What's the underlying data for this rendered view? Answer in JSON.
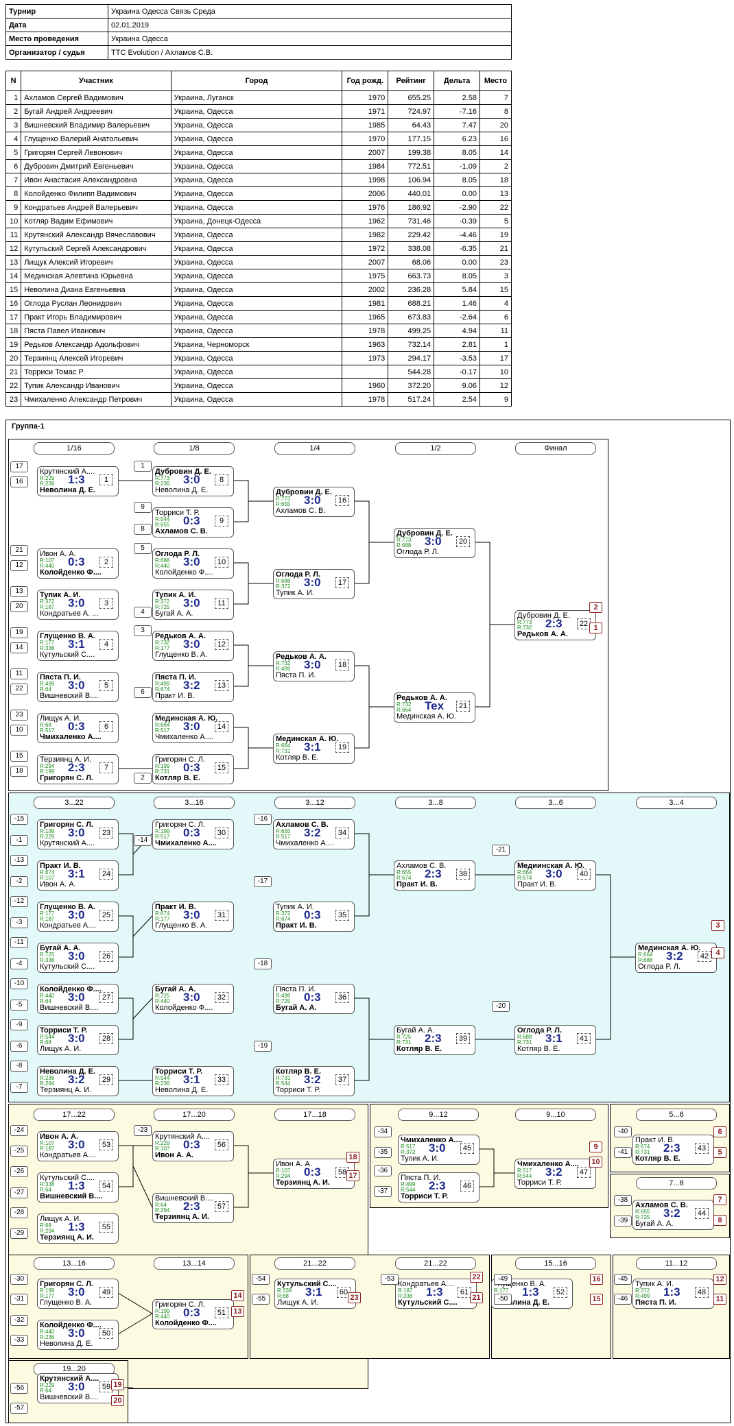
{
  "info": [
    {
      "k": "Турнир",
      "v": "Украина Одесса Связь Среда"
    },
    {
      "k": "Дата",
      "v": "02.01.2019"
    },
    {
      "k": "Место проведения",
      "v": "Украина Одесса"
    },
    {
      "k": "Организатор / судья",
      "v": "TTC Evolution / Ахламов С.В."
    }
  ],
  "players_header": [
    "N",
    "Участник",
    "Город",
    "Год рожд.",
    "Рейтинг",
    "Дельта",
    "Место"
  ],
  "players": [
    [
      "1",
      "Ахламов Сергей Вадимович",
      "Украина, Луганск",
      "1970",
      "655.25",
      "2.58",
      "7"
    ],
    [
      "2",
      "Бугай Андрей Андреевич",
      "Украина, Одесса",
      "1971",
      "724.97",
      "-7.16",
      "8"
    ],
    [
      "3",
      "Вишневский Владимир Валерьевич",
      "Украина, Одесса",
      "1985",
      "64.43",
      "7.47",
      "20"
    ],
    [
      "4",
      "Глущенко Валерий Анатольевич",
      "Украина, Одесса",
      "1970",
      "177.15",
      "6.23",
      "16"
    ],
    [
      "5",
      "Григорян Сергей Левонович",
      "Украина, Одесса",
      "2007",
      "199.38",
      "8.05",
      "14"
    ],
    [
      "6",
      "Дубровин Дмитрий Евгеньевич",
      "Украина, Одесса",
      "1984",
      "772.51",
      "-1.09",
      "2"
    ],
    [
      "7",
      "Ивон Анастасия Александровна",
      "Украина, Одесса",
      "1998",
      "106.94",
      "8.05",
      "18"
    ],
    [
      "8",
      "Колойденко Филипп Вадимович",
      "Украина, Одесса",
      "2006",
      "440.01",
      "0.00",
      "13"
    ],
    [
      "9",
      "Кондратьев Андрей Валерьевич",
      "Украина, Одесса",
      "1976",
      "186.92",
      "-2.90",
      "22"
    ],
    [
      "10",
      "Котляр Вадим Ефимович",
      "Украина, Донецк-Одесса",
      "1962",
      "731.46",
      "-0.39",
      "5"
    ],
    [
      "11",
      "Крутянский Александр Вячеславович",
      "Украина, Одесса",
      "1982",
      "229.42",
      "-4.46",
      "19"
    ],
    [
      "12",
      "Кутульский Сергей Александрович",
      "Украина, Одесса",
      "1972",
      "338.08",
      "-6.35",
      "21"
    ],
    [
      "13",
      "Лищук Алексий Игоревич",
      "Украина, Одесса",
      "2007",
      "68.06",
      "0.00",
      "23"
    ],
    [
      "14",
      "Мединская Алевтина Юрьевна",
      "Украина, Одесса",
      "1975",
      "663.73",
      "8.05",
      "3"
    ],
    [
      "15",
      "Неволина Диана Евгеньевна",
      "Украина, Одесса",
      "2002",
      "236.28",
      "5.84",
      "15"
    ],
    [
      "16",
      "Оглода Руслан Леонидович",
      "Украина, Одесса",
      "1981",
      "688.21",
      "1.46",
      "4"
    ],
    [
      "17",
      "Практ Игорь Владимирович",
      "Украина, Одесса",
      "1965",
      "673.83",
      "-2.64",
      "6"
    ],
    [
      "18",
      "Пяста Павел Иванович",
      "Украина, Одесса",
      "1978",
      "499.25",
      "4.94",
      "11"
    ],
    [
      "19",
      "Редьков Александр Адольфович",
      "Украина, Черноморск",
      "1963",
      "732.14",
      "2.81",
      "1"
    ],
    [
      "20",
      "Терзиянц Алексей Игоревич",
      "Украина, Одесса",
      "1973",
      "294.17",
      "-3.53",
      "17"
    ],
    [
      "21",
      "Торриси Томас Р",
      "Украина, Одесса",
      "",
      "544.28",
      "-0.17",
      "10"
    ],
    [
      "22",
      "Тупик Александр Иванович",
      "Украина, Одесса",
      "1960",
      "372.20",
      "9.06",
      "12"
    ],
    [
      "23",
      "Чмихаленко Александр Петрович",
      "Украина, Одесса",
      "1978",
      "517.24",
      "2.54",
      "9"
    ]
  ],
  "group_title": "Группа-1",
  "rounds": [
    {
      "label": "1/16"
    },
    {
      "label": "1/8"
    },
    {
      "label": "1/4"
    },
    {
      "label": "1/2"
    },
    {
      "label": "Финал"
    },
    {
      "label": "3...22"
    },
    {
      "label": "3...16"
    },
    {
      "label": "3...12"
    },
    {
      "label": "3...8"
    },
    {
      "label": "3...6"
    },
    {
      "label": "3...4"
    },
    {
      "label": "17...22"
    },
    {
      "label": "17...20"
    },
    {
      "label": "17...18"
    },
    {
      "label": "9...12"
    },
    {
      "label": "9...10"
    },
    {
      "label": "5...6"
    },
    {
      "label": "7...8"
    },
    {
      "label": "13...16"
    },
    {
      "label": "13...14"
    },
    {
      "label": "21...22"
    },
    {
      "label": "21...22"
    },
    {
      "label": "15...16"
    },
    {
      "label": "11...12"
    },
    {
      "label": "19...20"
    }
  ],
  "matches": [
    {
      "t": "Крутянский А....",
      "b": "Неволина Д. Е.",
      "r1": "R:229",
      "r2": "R:236",
      "s": "1:3",
      "n": "1",
      "w": "b"
    },
    {
      "t": "Ивон А. А.",
      "b": "Колойденко Ф....",
      "r1": "R:107",
      "r2": "R:440",
      "s": "0:3",
      "n": "2",
      "w": "b"
    },
    {
      "t": "Тупик А. И.",
      "b": "Кондратьев А. ...",
      "r1": "R:372",
      "r2": "R:187",
      "s": "3:0",
      "n": "3",
      "w": "t"
    },
    {
      "t": "Глущенко В. А.",
      "b": "Кутульский С....",
      "r1": "R:177",
      "r2": "R:338",
      "s": "3:1",
      "n": "4",
      "w": "t"
    },
    {
      "t": "Пяста П. И.",
      "b": "Вишневский В....",
      "r1": "R:499",
      "r2": "R:64",
      "s": "3:0",
      "n": "5",
      "w": "t"
    },
    {
      "t": "Лищук А. И.",
      "b": "Чмихаленко А....",
      "r1": "R:68",
      "r2": "R:517",
      "s": "0:3",
      "n": "6",
      "w": "b"
    },
    {
      "t": "Терзиянц А. И.",
      "b": "Григорян С. Л.",
      "r1": "R:294",
      "r2": "R:199",
      "s": "2:3",
      "n": "7",
      "w": "b"
    },
    {
      "t": "Дубровин Д. Е.",
      "b": "Неволина Д. Е.",
      "r1": "R:773",
      "r2": "R:236",
      "s": "3:0",
      "n": "8",
      "w": "t"
    },
    {
      "t": "Торриси Т. Р.",
      "b": "Ахламов С. В.",
      "r1": "R:544",
      "r2": "R:655",
      "s": "0:3",
      "n": "9",
      "w": "b"
    },
    {
      "t": "Оглода Р. Л.",
      "b": "Колойденко Ф....",
      "r1": "R:688",
      "r2": "R:440",
      "s": "3:0",
      "n": "10",
      "w": "t"
    },
    {
      "t": "Тупик А. И.",
      "b": "Бугай А. А.",
      "r1": "R:372",
      "r2": "R:725",
      "s": "3:0",
      "n": "11",
      "w": "t"
    },
    {
      "t": "Редьков А. А.",
      "b": "Глущенко В. А.",
      "r1": "R:732",
      "r2": "R:177",
      "s": "3:0",
      "n": "12",
      "w": "t"
    },
    {
      "t": "Пяста П. И.",
      "b": "Практ И. В.",
      "r1": "R:499",
      "r2": "R:674",
      "s": "3:2",
      "n": "13",
      "w": "t"
    },
    {
      "t": "Мединская А. Ю.",
      "b": "Чмихаленко А....",
      "r1": "R:664",
      "r2": "R:517",
      "s": "3:0",
      "n": "14",
      "w": "t"
    },
    {
      "t": "Григорян С. Л.",
      "b": "Котляр В. Е.",
      "r1": "R:199",
      "r2": "R:731",
      "s": "0:3",
      "n": "15",
      "w": "b"
    },
    {
      "t": "Дубровин Д. Е.",
      "b": "Ахламов С. В.",
      "r1": "R:773",
      "r2": "R:655",
      "s": "3:0",
      "n": "16",
      "w": "t"
    },
    {
      "t": "Оглода Р. Л.",
      "b": "Тупик А. И.",
      "r1": "R:688",
      "r2": "R:372",
      "s": "3:0",
      "n": "17",
      "w": "t"
    },
    {
      "t": "Редьков А. А.",
      "b": "Пяста П. И.",
      "r1": "R:732",
      "r2": "R:499",
      "s": "3:0",
      "n": "18",
      "w": "t"
    },
    {
      "t": "Мединская А. Ю.",
      "b": "Котляр В. Е.",
      "r1": "R:664",
      "r2": "R:731",
      "s": "3:1",
      "n": "19",
      "w": "t"
    },
    {
      "t": "Дубровин Д. Е.",
      "b": "Оглода Р. Л.",
      "r1": "R:773",
      "r2": "R:688",
      "s": "3:0",
      "n": "20",
      "w": "t"
    },
    {
      "t": "Редьков А. А.",
      "b": "Мединская А. Ю.",
      "r1": "R:732",
      "r2": "R:664",
      "s": "Tex",
      "n": "21",
      "w": "t"
    },
    {
      "t": "Дубровин Д. Е.",
      "b": "Редьков А. А.",
      "r1": "R:773",
      "r2": "R:732",
      "s": "2:3",
      "n": "22",
      "w": "b"
    },
    {
      "t": "Григорян С. Л.",
      "b": "Крутянский А....",
      "r1": "R:199",
      "r2": "R:229",
      "s": "3:0",
      "n": "23",
      "w": "t"
    },
    {
      "t": "Практ И. В.",
      "b": "Ивон А. А.",
      "r1": "R:674",
      "r2": "R:107",
      "s": "3:1",
      "n": "24",
      "w": "t"
    },
    {
      "t": "Глущенко В. А.",
      "b": "Кондратьев А....",
      "r1": "R:177",
      "r2": "R:187",
      "s": "3:0",
      "n": "25",
      "w": "t"
    },
    {
      "t": "Бугай А. А.",
      "b": "Кутульский С....",
      "r1": "R:725",
      "r2": "R:338",
      "s": "3:0",
      "n": "26",
      "w": "t"
    },
    {
      "t": "Колойденко Ф....",
      "b": "Вишневский В....",
      "r1": "R:440",
      "r2": "R:64",
      "s": "3:0",
      "n": "27",
      "w": "t"
    },
    {
      "t": "Торриси Т. Р.",
      "b": "Лищук А. И.",
      "r1": "R:544",
      "r2": "R:68",
      "s": "3:0",
      "n": "28",
      "w": "t"
    },
    {
      "t": "Неволина Д. Е.",
      "b": "Терзиянц А. И.",
      "r1": "R:236",
      "r2": "R:294",
      "s": "3:2",
      "n": "29",
      "w": "t"
    },
    {
      "t": "Григорян С. Л.",
      "b": "Чмихаленко А....",
      "r1": "R:199",
      "r2": "R:517",
      "s": "0:3",
      "n": "30",
      "w": "b"
    },
    {
      "t": "Практ И. В.",
      "b": "Глущенко В. А.",
      "r1": "R:674",
      "r2": "R:177",
      "s": "3:0",
      "n": "31",
      "w": "t"
    },
    {
      "t": "Бугай А. А.",
      "b": "Колойденко Ф....",
      "r1": "R:725",
      "r2": "R:440",
      "s": "3:0",
      "n": "32",
      "w": "t"
    },
    {
      "t": "Торриси Т. Р.",
      "b": "Неволина Д. Е.",
      "r1": "R:544",
      "r2": "R:236",
      "s": "3:1",
      "n": "33",
      "w": "t"
    },
    {
      "t": "Ахламов С. В.",
      "b": "Чмихаленко А....",
      "r1": "R:655",
      "r2": "R:517",
      "s": "3:2",
      "n": "34",
      "w": "t"
    },
    {
      "t": "Тупик А. И.",
      "b": "Практ И. В.",
      "r1": "R:372",
      "r2": "R:674",
      "s": "0:3",
      "n": "35",
      "w": "b"
    },
    {
      "t": "Пяста П. И.",
      "b": "Бугай А. А.",
      "r1": "R:499",
      "r2": "R:725",
      "s": "0:3",
      "n": "36",
      "w": "b"
    },
    {
      "t": "Котляр В. Е.",
      "b": "Торриси Т. Р.",
      "r1": "R:731",
      "r2": "R:544",
      "s": "3:2",
      "n": "37",
      "w": "t"
    },
    {
      "t": "Ахламов С. В.",
      "b": "Практ И. В.",
      "r1": "R:655",
      "r2": "R:674",
      "s": "2:3",
      "n": "38",
      "w": "b"
    },
    {
      "t": "Бугай А. А.",
      "b": "Котляр В. Е.",
      "r1": "R:725",
      "r2": "R:731",
      "s": "2:3",
      "n": "39",
      "w": "b"
    },
    {
      "t": "Медиинская А. Ю.",
      "b": "Практ И. В.",
      "r1": "R:664",
      "r2": "R:674",
      "s": "3:0",
      "n": "40",
      "w": "t"
    },
    {
      "t": "Оглода Р. Л.",
      "b": "Котляр В. Е.",
      "r1": "R:688",
      "r2": "R:731",
      "s": "3:1",
      "n": "41",
      "w": "t"
    },
    {
      "t": "Мединская А. Ю.",
      "b": "Оглода Р. Л.",
      "r1": "R:664",
      "r2": "R:688",
      "s": "3:2",
      "n": "42",
      "w": "t"
    },
    {
      "t": "Практ И. В.",
      "b": "Котляр В. Е.",
      "r1": "R:674",
      "r2": "R:731",
      "s": "2:3",
      "n": "43",
      "w": "b"
    },
    {
      "t": "Ахламов С. В.",
      "b": "Бугай А. А.",
      "r1": "R:655",
      "r2": "R:725",
      "s": "3:2",
      "n": "44",
      "w": "t"
    },
    {
      "t": "Чмихаленко А....",
      "b": "Тупик А. И.",
      "r1": "R:517",
      "r2": "R:372",
      "s": "3:0",
      "n": "45",
      "w": "t"
    },
    {
      "t": "Пяста П. И.",
      "b": "Торриси Т. Р.",
      "r1": "R:499",
      "r2": "R:544",
      "s": "2:3",
      "n": "46",
      "w": "b"
    },
    {
      "t": "Чмихаленко А....",
      "b": "Торриси Т. Р.",
      "r1": "R:517",
      "r2": "R:544",
      "s": "3:2",
      "n": "47",
      "w": "t"
    },
    {
      "t": "Тупик А. И.",
      "b": "Пяста П. И.",
      "r1": "R:372",
      "r2": "R:499",
      "s": "1:3",
      "n": "48",
      "w": "b"
    },
    {
      "t": "Григорян С. Л.",
      "b": "Глущенко В. А.",
      "r1": "R:199",
      "r2": "R:177",
      "s": "3:0",
      "n": "49",
      "w": "t"
    },
    {
      "t": "Колойденко Ф....",
      "b": "Неволина Д. Е.",
      "r1": "R:440",
      "r2": "R:236",
      "s": "3:0",
      "n": "50",
      "w": "t"
    },
    {
      "t": "Григорян С. Л.",
      "b": "Колойденко Ф....",
      "r1": "R:199",
      "r2": "R:440",
      "s": "0:3",
      "n": "51",
      "w": "b"
    },
    {
      "t": "Глущенко В. А.",
      "b": "Неволина Д. Е.",
      "r1": "R:177",
      "r2": "R:236",
      "s": "1:3",
      "n": "52",
      "w": "b"
    },
    {
      "t": "Ивон А. А.",
      "b": "Кондратьев А....",
      "r1": "R:107",
      "r2": "R:187",
      "s": "3:0",
      "n": "53",
      "w": "t"
    },
    {
      "t": "Кутульский С....",
      "b": "Вишневский В....",
      "r1": "R:338",
      "r2": "R:64",
      "s": "1:3",
      "n": "54",
      "w": "b"
    },
    {
      "t": "Лищук А. И.",
      "b": "Терзиянц А. И.",
      "r1": "R:68",
      "r2": "R:294",
      "s": "1:3",
      "n": "55",
      "w": "b"
    },
    {
      "t": "Крутянский А....",
      "b": "Ивон А. А.",
      "r1": "R:229",
      "r2": "R:107",
      "s": "0:3",
      "n": "56",
      "w": "b"
    },
    {
      "t": "Вишневский В....",
      "b": "Терзиянц А. И.",
      "r1": "R:64",
      "r2": "R:294",
      "s": "2:3",
      "n": "57",
      "w": "b"
    },
    {
      "t": "Ивон А. А.",
      "b": "Терзиянц А. И.",
      "r1": "R:107",
      "r2": "R:294",
      "s": "0:3",
      "n": "58",
      "w": "b"
    },
    {
      "t": "Крутянский А....",
      "b": "Вишневский В....",
      "r1": "R:229",
      "r2": "R:64",
      "s": "3:0",
      "n": "59",
      "w": "t"
    },
    {
      "t": "Кутульский С....",
      "b": "Лищук А. И.",
      "r1": "R:338",
      "r2": "R:68",
      "s": "3:1",
      "n": "60",
      "w": "t"
    },
    {
      "t": "Кондратьев А....",
      "b": "Кутульский С....",
      "r1": "R:187",
      "r2": "R:338",
      "s": "1:3",
      "n": "61",
      "w": "b"
    }
  ],
  "seeds": [
    "17",
    "16",
    "21",
    "12",
    "13",
    "20",
    "19",
    "14",
    "11",
    "22",
    "23",
    "10",
    "15",
    "18",
    "1",
    "9",
    "8",
    "5",
    "4",
    "3",
    "6",
    "2",
    "-15",
    "-1",
    "-13",
    "-2",
    "-12",
    "-3",
    "-11",
    "-4",
    "-10",
    "-5",
    "-9",
    "-6",
    "-8",
    "-7",
    "-14",
    "-16",
    "-17",
    "-18",
    "-19",
    "-21",
    "-20",
    "-24",
    "-25",
    "-26",
    "-27",
    "-28",
    "-29",
    "-23",
    "-34",
    "-35",
    "-36",
    "-37",
    "-40",
    "-41",
    "-38",
    "-39",
    "-30",
    "-31",
    "-32",
    "-33",
    "-54",
    "-55",
    "-53",
    "-49",
    "-50",
    "-45",
    "-46",
    "-56",
    "-57"
  ],
  "places": [
    "2",
    "1",
    "3",
    "4",
    "18",
    "17",
    "9",
    "10",
    "6",
    "5",
    "7",
    "8",
    "14",
    "13",
    "22",
    "23",
    "21",
    "16",
    "15",
    "12",
    "11",
    "19",
    "20"
  ],
  "losers": [
    "-23",
    "-24",
    "-25",
    "-26",
    "-27",
    "-28",
    "-29",
    "-29",
    "-28",
    "-27",
    "-26",
    "-25",
    "-24",
    "-23",
    "-34",
    "-35",
    "-36",
    "-37",
    "-41",
    "-40",
    "-56",
    "-49",
    "-53",
    "-53",
    "-54",
    "-54",
    "-55",
    "-55",
    "-49",
    "-50",
    "-50",
    "-45",
    "-45",
    "-46",
    "-46",
    "-44",
    "-44",
    "-43",
    "-43",
    "-61",
    "-60",
    "-60",
    "-59",
    "-59",
    "-48",
    "-48",
    "-52",
    "-52"
  ]
}
